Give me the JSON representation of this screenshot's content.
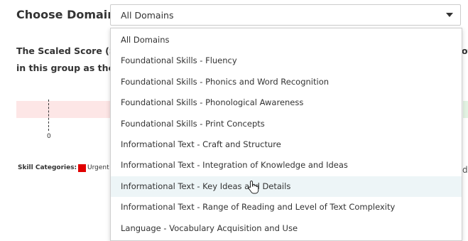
{
  "header": {
    "choose_label": "Choose Domain",
    "selected_value": "All Domains"
  },
  "description": {
    "line1": "The Scaled Score (SS)",
    "line1_right": "of",
    "line2": "in this group as they i"
  },
  "chart": {
    "zero_label": "0"
  },
  "legend": {
    "skill_label": "Skill Categories:",
    "urgent_label": "Urgent",
    "urgent_color": "#e00000",
    "right_fragment": "d"
  },
  "dropdown": {
    "hovered_index": 7,
    "options": [
      "All Domains",
      "Foundational Skills - Fluency",
      "Foundational Skills - Phonics and Word Recognition",
      "Foundational Skills - Phonological Awareness",
      "Foundational Skills - Print Concepts",
      "Informational Text - Craft and Structure",
      "Informational Text - Integration of Knowledge and Ideas",
      "Informational Text - Key Ideas and Details",
      "Informational Text - Range of Reading and Level of Text Complexity",
      "Language - Vocabulary Acquisition and Use"
    ]
  },
  "icons": {
    "caret": "chevron-down-icon",
    "cursor": "hand-pointer-icon"
  }
}
